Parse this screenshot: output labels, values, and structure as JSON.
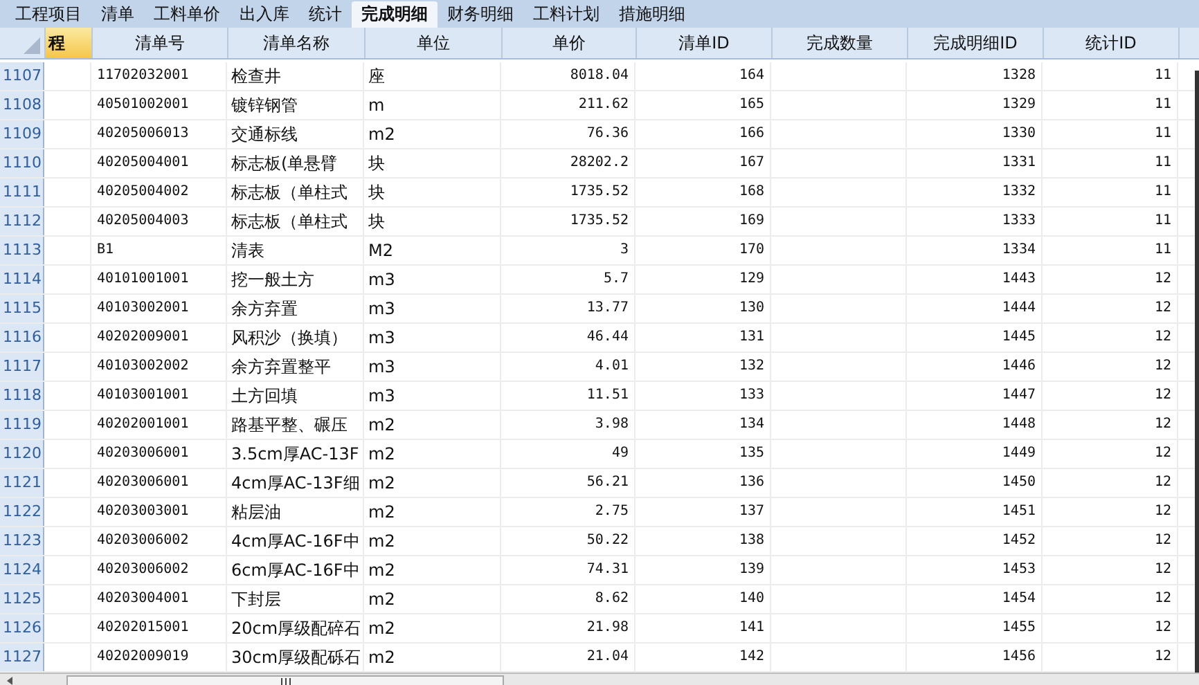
{
  "tabs": [
    {
      "label": "工程项目",
      "selected": false
    },
    {
      "label": "清单",
      "selected": false
    },
    {
      "label": "工料单价",
      "selected": false
    },
    {
      "label": "出入库",
      "selected": false
    },
    {
      "label": "统计",
      "selected": false
    },
    {
      "label": "完成明细",
      "selected": true
    },
    {
      "label": "财务明细",
      "selected": false
    },
    {
      "label": "工料计划",
      "selected": false
    },
    {
      "label": "措施明细",
      "selected": false
    }
  ],
  "table": {
    "columns": [
      {
        "label": "程",
        "selected": true
      },
      {
        "label": "清单号",
        "selected": false
      },
      {
        "label": "清单名称",
        "selected": false
      },
      {
        "label": "单位",
        "selected": false
      },
      {
        "label": "单价",
        "selected": false
      },
      {
        "label": "清单ID",
        "selected": false
      },
      {
        "label": "完成数量",
        "selected": false
      },
      {
        "label": "完成明细ID",
        "selected": false
      },
      {
        "label": "统计ID",
        "selected": false
      }
    ],
    "rows": [
      {
        "row_number": "1107",
        "code": "11702032001",
        "name": "检查井",
        "unit": "座",
        "price": "8018.04",
        "list_id": "164",
        "detail_id": "1328",
        "stat_id": "11"
      },
      {
        "row_number": "1108",
        "code": "40501002001",
        "name": "镀锌钢管",
        "unit": "m",
        "price": "211.62",
        "list_id": "165",
        "detail_id": "1329",
        "stat_id": "11"
      },
      {
        "row_number": "1109",
        "code": "40205006013",
        "name": "交通标线",
        "unit": "m2",
        "price": "76.36",
        "list_id": "166",
        "detail_id": "1330",
        "stat_id": "11"
      },
      {
        "row_number": "1110",
        "code": "40205004001",
        "name": "标志板(单悬臂",
        "unit": "块",
        "price": "28202.2",
        "list_id": "167",
        "detail_id": "1331",
        "stat_id": "11"
      },
      {
        "row_number": "1111",
        "code": "40205004002",
        "name": "标志板（单柱式",
        "unit": "块",
        "price": "1735.52",
        "list_id": "168",
        "detail_id": "1332",
        "stat_id": "11"
      },
      {
        "row_number": "1112",
        "code": "40205004003",
        "name": "标志板（单柱式",
        "unit": "块",
        "price": "1735.52",
        "list_id": "169",
        "detail_id": "1333",
        "stat_id": "11"
      },
      {
        "row_number": "1113",
        "code": "B1",
        "name": "清表",
        "unit": "M2",
        "price": "3",
        "list_id": "170",
        "detail_id": "1334",
        "stat_id": "11"
      },
      {
        "row_number": "1114",
        "code": "40101001001",
        "name": "挖一般土方",
        "unit": "m3",
        "price": "5.7",
        "list_id": "129",
        "detail_id": "1443",
        "stat_id": "12"
      },
      {
        "row_number": "1115",
        "code": "40103002001",
        "name": "余方弃置",
        "unit": "m3",
        "price": "13.77",
        "list_id": "130",
        "detail_id": "1444",
        "stat_id": "12"
      },
      {
        "row_number": "1116",
        "code": "40202009001",
        "name": "风积沙（换填）",
        "unit": "m3",
        "price": "46.44",
        "list_id": "131",
        "detail_id": "1445",
        "stat_id": "12"
      },
      {
        "row_number": "1117",
        "code": "40103002002",
        "name": "余方弃置整平",
        "unit": "m3",
        "price": "4.01",
        "list_id": "132",
        "detail_id": "1446",
        "stat_id": "12"
      },
      {
        "row_number": "1118",
        "code": "40103001001",
        "name": "土方回填",
        "unit": "m3",
        "price": "11.51",
        "list_id": "133",
        "detail_id": "1447",
        "stat_id": "12"
      },
      {
        "row_number": "1119",
        "code": "40202001001",
        "name": "路基平整、碾压",
        "unit": "m2",
        "price": "3.98",
        "list_id": "134",
        "detail_id": "1448",
        "stat_id": "12"
      },
      {
        "row_number": "1120",
        "code": "40203006001",
        "name": "3.5cm厚AC-13F",
        "unit": "m2",
        "price": "49",
        "list_id": "135",
        "detail_id": "1449",
        "stat_id": "12"
      },
      {
        "row_number": "1121",
        "code": "40203006001",
        "name": "4cm厚AC-13F细",
        "unit": "m2",
        "price": "56.21",
        "list_id": "136",
        "detail_id": "1450",
        "stat_id": "12"
      },
      {
        "row_number": "1122",
        "code": "40203003001",
        "name": "粘层油",
        "unit": "m2",
        "price": "2.75",
        "list_id": "137",
        "detail_id": "1451",
        "stat_id": "12"
      },
      {
        "row_number": "1123",
        "code": "40203006002",
        "name": "4cm厚AC-16F中",
        "unit": "m2",
        "price": "50.22",
        "list_id": "138",
        "detail_id": "1452",
        "stat_id": "12"
      },
      {
        "row_number": "1124",
        "code": "40203006002",
        "name": "6cm厚AC-16F中",
        "unit": "m2",
        "price": "74.31",
        "list_id": "139",
        "detail_id": "1453",
        "stat_id": "12"
      },
      {
        "row_number": "1125",
        "code": "40203004001",
        "name": "下封层",
        "unit": "m2",
        "price": "8.62",
        "list_id": "140",
        "detail_id": "1454",
        "stat_id": "12"
      },
      {
        "row_number": "1126",
        "code": "40202015001",
        "name": "20cm厚级配碎石",
        "unit": "m2",
        "price": "21.98",
        "list_id": "141",
        "detail_id": "1455",
        "stat_id": "12"
      },
      {
        "row_number": "1127",
        "code": "40202009019",
        "name": "30cm厚级配砾石",
        "unit": "m2",
        "price": "21.04",
        "list_id": "142",
        "detail_id": "1456",
        "stat_id": "12"
      }
    ]
  }
}
